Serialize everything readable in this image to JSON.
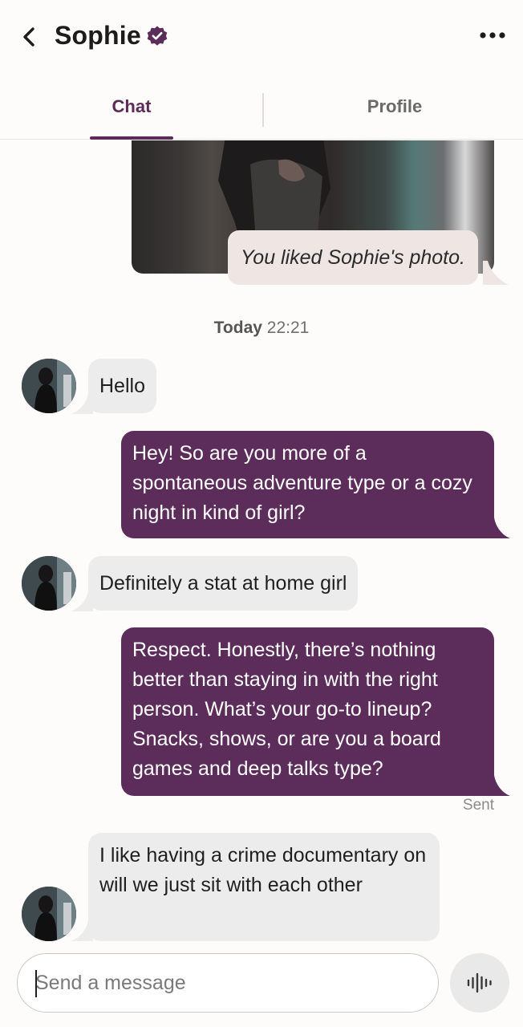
{
  "header": {
    "title": "Sophie",
    "back_icon": "chevron-left-icon",
    "verified_icon": "verified-badge-icon",
    "more_icon": "more-horizontal-icon"
  },
  "tabs": [
    {
      "label": "Chat",
      "active": true
    },
    {
      "label": "Profile",
      "active": false
    }
  ],
  "chat": {
    "liked_photo_text": "You liked Sophie's photo.",
    "date_separator": {
      "day": "Today",
      "time": "22:21"
    },
    "messages": [
      {
        "direction": "in",
        "text": "Hello"
      },
      {
        "direction": "out",
        "text": "Hey! So are you more of a spontaneous adventure type or a cozy night in kind of girl?"
      },
      {
        "direction": "in",
        "text": "Definitely a stat at home girl"
      },
      {
        "direction": "out",
        "text": "Respect. Honestly, there’s nothing better than staying in with the right person. What’s your go-to lineup? Snacks, shows, or are you a board games and deep talks type?"
      },
      {
        "direction": "in",
        "text": "I like having a crime documentary on will we just sit with each other"
      }
    ],
    "sent_status": "Sent"
  },
  "composer": {
    "placeholder": "Send a message",
    "voice_icon": "voice-waveform-icon"
  },
  "colors": {
    "accent": "#5c2c5a",
    "incoming_bubble": "#ececec",
    "liked_bubble": "#efe6e4"
  }
}
